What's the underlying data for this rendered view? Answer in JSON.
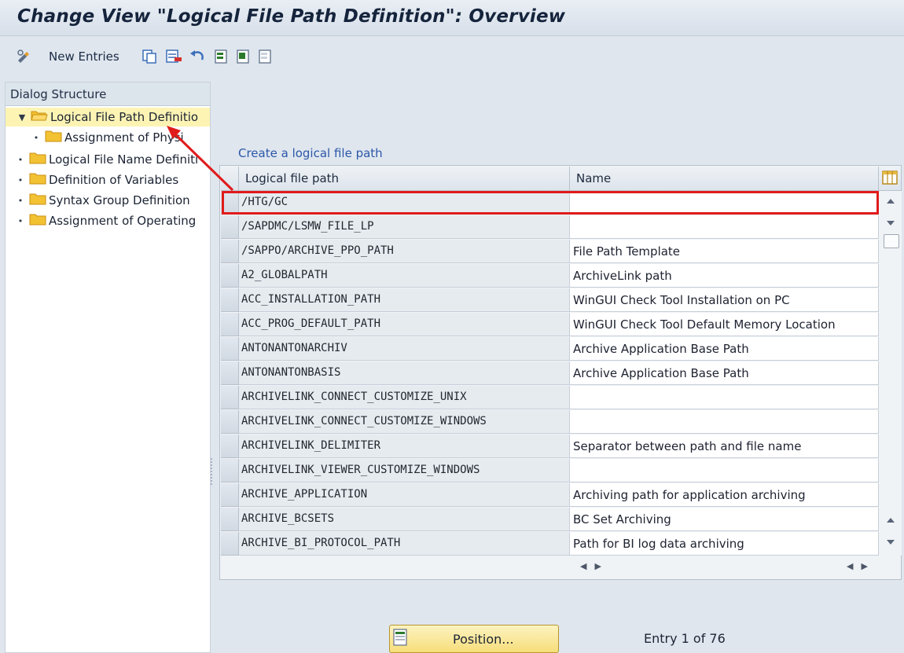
{
  "window": {
    "title": "Change View \"Logical File Path Definition\": Overview"
  },
  "toolbar": {
    "new_entries_label": "New Entries",
    "icons": [
      "display-change-icon",
      "copy-icon",
      "delete-icon",
      "undo-icon",
      "select-all-icon",
      "select-block-icon",
      "deselect-all-icon"
    ]
  },
  "dialog_structure": {
    "header": "Dialog Structure",
    "items": [
      {
        "label": "Logical File Path Definitio",
        "level": 0,
        "expanded": true,
        "selected": true
      },
      {
        "label": "Assignment of Physi",
        "level": 1
      },
      {
        "label": "Logical File Name Definiti",
        "level": 0
      },
      {
        "label": "Definition of Variables",
        "level": 0
      },
      {
        "label": "Syntax Group Definition",
        "level": 0
      },
      {
        "label": "Assignment of Operating",
        "level": 0
      }
    ]
  },
  "table": {
    "title_link": "Create a logical file path",
    "columns": [
      "Logical file path",
      "Name"
    ],
    "rows": [
      {
        "path": "/HTG/GC",
        "name": ""
      },
      {
        "path": "/SAPDMC/LSMW_FILE_LP",
        "name": ""
      },
      {
        "path": "/SAPPO/ARCHIVE_PPO_PATH",
        "name": "File Path Template"
      },
      {
        "path": "A2_GLOBALPATH",
        "name": "ArchiveLink path"
      },
      {
        "path": "ACC_INSTALLATION_PATH",
        "name": "WinGUI Check Tool Installation on PC"
      },
      {
        "path": "ACC_PROG_DEFAULT_PATH",
        "name": "WinGUI Check Tool Default Memory Location"
      },
      {
        "path": "ANTONANTONARCHIV",
        "name": "Archive Application Base Path"
      },
      {
        "path": "ANTONANTONBASIS",
        "name": "Archive Application Base Path"
      },
      {
        "path": "ARCHIVELINK_CONNECT_CUSTOMIZE_UNIX",
        "name": ""
      },
      {
        "path": "ARCHIVELINK_CONNECT_CUSTOMIZE_WINDOWS",
        "name": ""
      },
      {
        "path": "ARCHIVELINK_DELIMITER",
        "name": "Separator between path and file name"
      },
      {
        "path": "ARCHIVELINK_VIEWER_CUSTOMIZE_WINDOWS",
        "name": ""
      },
      {
        "path": "ARCHIVE_APPLICATION",
        "name": "Archiving path for application archiving"
      },
      {
        "path": "ARCHIVE_BCSETS",
        "name": "BC Set Archiving"
      },
      {
        "path": "ARCHIVE_BI_PROTOCOL_PATH",
        "name": "Path for BI log data archiving"
      }
    ]
  },
  "footer": {
    "position_button": "Position...",
    "entry_count": "Entry 1 of 76"
  },
  "colors": {
    "highlight": "#e01b1b",
    "selected_tree_bg": "#fdf4b4",
    "folder": "#f3c233",
    "link": "#2c57a8"
  }
}
